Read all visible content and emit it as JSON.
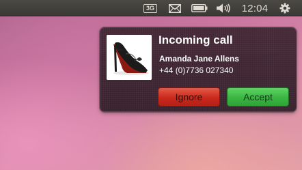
{
  "panel": {
    "network_badge": "3G",
    "clock": "12:04",
    "icons": [
      "mail-icon",
      "battery-icon",
      "volume-icon",
      "gear-icon"
    ]
  },
  "notification": {
    "title": "Incoming call",
    "caller_name": "Amanda Jane Allens",
    "caller_number": "+44 (0)7736 027340",
    "ignore_label": "Ignore",
    "accept_label": "Accept",
    "colors": {
      "ignore": "#c9291c",
      "accept": "#3ab542"
    }
  }
}
